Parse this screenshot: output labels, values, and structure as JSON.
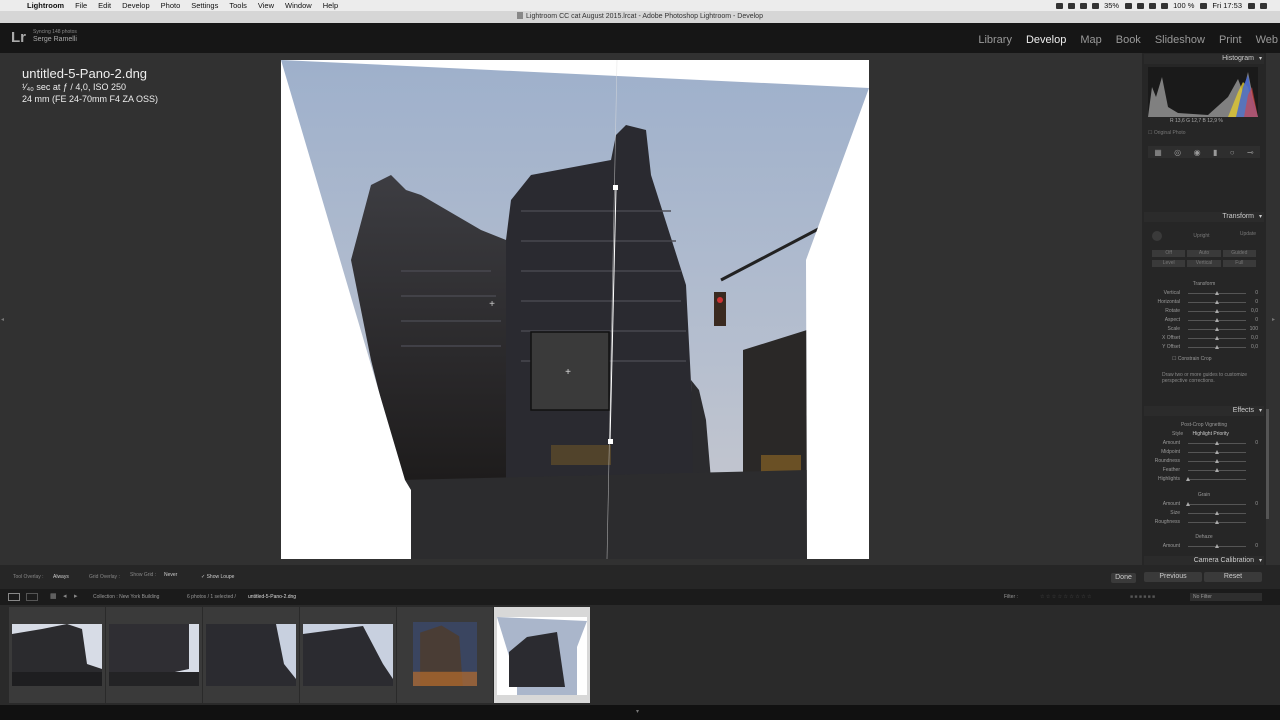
{
  "menubar": {
    "app": "Lightroom",
    "menus": [
      "File",
      "Edit",
      "Develop",
      "Photo",
      "Settings",
      "Tools",
      "View",
      "Window",
      "Help"
    ],
    "battery": "35%",
    "zoom": "100 %",
    "clock": "Fri 17:53"
  },
  "window": {
    "title": "Lightroom CC cat August 2015.lrcat - Adobe Photoshop Lightroom - Develop"
  },
  "identity": {
    "logo": "Lr",
    "sync_status": "Syncing 148 photos",
    "user": "Serge Ramelli"
  },
  "modules": [
    "Library",
    "Develop",
    "Map",
    "Book",
    "Slideshow",
    "Print",
    "Web"
  ],
  "active_module": "Develop",
  "photo_info": {
    "filename": "untitled-5-Pano-2.dng",
    "exposure": "¹⁄₄₀ sec at ƒ / 4,0, ISO 250",
    "lens": "24 mm (FE 24-70mm F4 ZA OSS)"
  },
  "histogram": {
    "title": "Histogram",
    "r_label": "R",
    "r_val": "13,6",
    "g_label": "G",
    "g_val": "12,7",
    "b_label": "B",
    "b_val": "12,9",
    "unit": "%",
    "original_photo": "Original Photo"
  },
  "transform": {
    "title": "Transform",
    "upright_label": "Upright",
    "update_label": "Update",
    "upright_buttons_row1": [
      "Off",
      "Auto",
      "Guided"
    ],
    "upright_buttons_row2": [
      "Level",
      "Vertical",
      "Full"
    ],
    "section_label": "Transform",
    "sliders": [
      {
        "label": "Vertical",
        "value": "0",
        "pos": 0.5
      },
      {
        "label": "Horizontal",
        "value": "0",
        "pos": 0.5
      },
      {
        "label": "Rotate",
        "value": "0,0",
        "pos": 0.5
      },
      {
        "label": "Aspect",
        "value": "0",
        "pos": 0.5
      },
      {
        "label": "Scale",
        "value": "100",
        "pos": 0.5
      },
      {
        "label": "X Offset",
        "value": "0,0",
        "pos": 0.5
      },
      {
        "label": "Y Offset",
        "value": "0,0",
        "pos": 0.5
      }
    ],
    "constrain_crop": "Constrain Crop",
    "hint": "Draw two or more guides to customize perspective corrections."
  },
  "effects": {
    "title": "Effects",
    "vignette_title": "Post-Crop Vignetting",
    "style_label": "Style",
    "style_value": "Highlight Priority",
    "vignette_sliders": [
      {
        "label": "Amount",
        "value": "0",
        "pos": 0.5
      },
      {
        "label": "Midpoint",
        "value": "",
        "pos": 0.5
      },
      {
        "label": "Roundness",
        "value": "",
        "pos": 0.5
      },
      {
        "label": "Feather",
        "value": "",
        "pos": 0.5
      },
      {
        "label": "Highlights",
        "value": "",
        "pos": 0.0
      }
    ],
    "grain_title": "Grain",
    "grain_sliders": [
      {
        "label": "Amount",
        "value": "0",
        "pos": 0.0
      },
      {
        "label": "Size",
        "value": "",
        "pos": 0.5
      },
      {
        "label": "Roughness",
        "value": "",
        "pos": 0.5
      }
    ],
    "dehaze_title": "Dehaze",
    "dehaze_slider": {
      "label": "Amount",
      "value": "0",
      "pos": 0.5
    }
  },
  "camera_calibration": {
    "title": "Camera Calibration"
  },
  "toolbar": {
    "tool_overlay_label": "Tool Overlay :",
    "tool_overlay_value": "Always",
    "grid_overlay_label": "Grid Overlay :",
    "show_grid_label": "Show Grid :",
    "show_grid_value": "Never",
    "show_loupe": "Show Loupe",
    "done": "Done",
    "previous": "Previous",
    "reset": "Reset"
  },
  "filmstrip": {
    "collection": "Collection : New York Building",
    "count": "6 photos / 1 selected /",
    "selected_file": "untitled-5-Pano-2.dng",
    "filter_label": "Filter :",
    "filter_value": "No Filter"
  },
  "colors": {
    "panel": "#262626",
    "canvas_bg": "#313131",
    "sky": "#a9b6cc"
  }
}
